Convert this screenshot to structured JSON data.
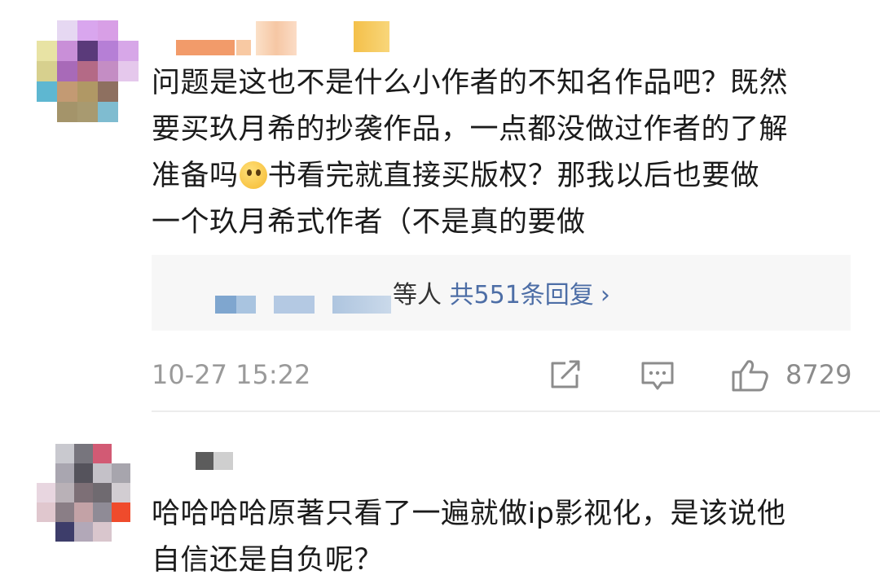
{
  "comments": [
    {
      "text_lines": [
        "问题是这也不是什么小作者的不知名作品吧？既然",
        "要买玖月希的抄袭作品，一点都没做过作者的了解",
        "准备吗",
        "书看完就直接买版权？那我以后也要做",
        "一个玖月希式作者（不是真的要做"
      ],
      "emoji_icon": "thinking-face-emoji",
      "replies": {
        "suffix": "等人",
        "count_text": "共551条回复",
        "chevron": "›"
      },
      "timestamp": "10-27 15:22",
      "likes": "8729",
      "actions": [
        "share-icon",
        "comment-icon",
        "like-icon"
      ]
    },
    {
      "text_lines": [
        "哈哈哈哈原著只看了一遍就做ip影视化，是该说他",
        "自信还是自负呢？"
      ]
    }
  ],
  "colors": {
    "link": "#4d6ea6",
    "meta_gray": "#9a9a9a",
    "reply_bg": "#f7f7f7"
  }
}
